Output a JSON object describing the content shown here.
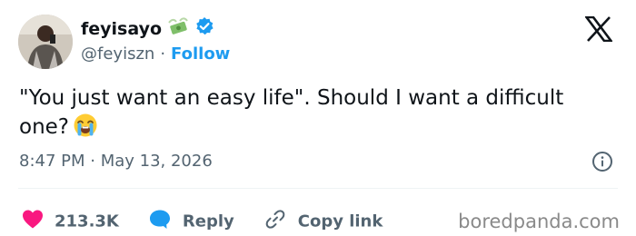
{
  "tweet": {
    "author_name": "feyisayo",
    "handle": "@feyiszn",
    "separator": "·",
    "follow_label": "Follow",
    "text": "\"You just want an easy life\". Should I want a difficult one?",
    "timestamp": "8:47 PM · May 13, 2026"
  },
  "actions": {
    "like_count": "213.3K",
    "reply_label": "Reply",
    "copy_link_label": "Copy link"
  },
  "watermark": "boredpanda.com",
  "icons": {
    "badge_emoji": "money-with-wings-icon",
    "verified": "verified-badge-icon",
    "text_emoji": "loudly-crying-face-icon",
    "logo": "x-logo-icon",
    "info": "info-icon",
    "like": "heart-icon",
    "reply": "reply-bubble-icon",
    "copy": "link-icon"
  },
  "colors": {
    "accent": "#1d9bf0",
    "text": "#0f1419",
    "secondary": "#536471",
    "like": "#f91880",
    "divider": "#eff3f4"
  }
}
